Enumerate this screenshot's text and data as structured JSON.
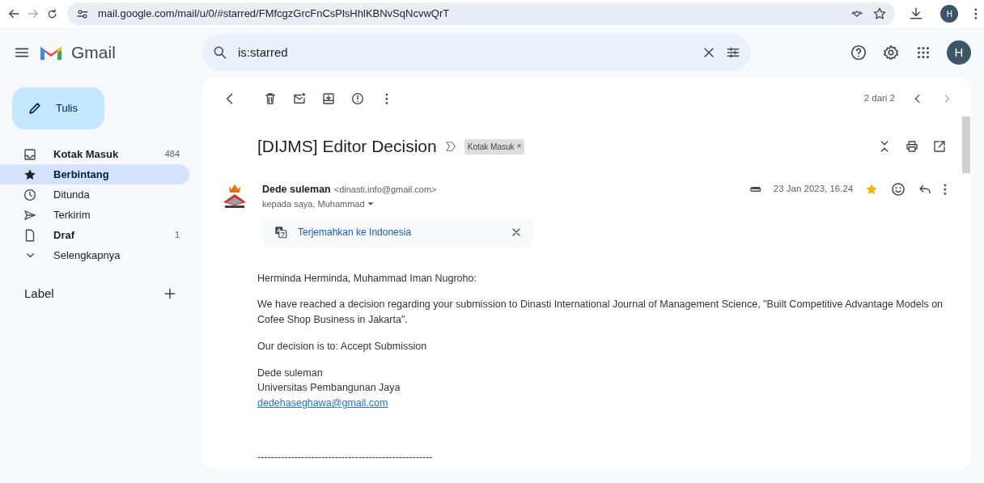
{
  "browser": {
    "url": "mail.google.com/mail/u/0/#starred/FMfcgzGrcFnCsPlsHhlKBNvSqNcvwQrT",
    "profile_initial": "H"
  },
  "header": {
    "app_name": "Gmail",
    "search": {
      "value": "is:starred"
    },
    "avatar_initial": "H"
  },
  "sidebar": {
    "compose": "Tulis",
    "items": [
      {
        "kind": "inbox",
        "label": "Kotak Masuk",
        "count": "484",
        "bold": true,
        "selected": false
      },
      {
        "kind": "star",
        "label": "Berbintang",
        "bold": true,
        "selected": true
      },
      {
        "kind": "clock",
        "label": "Ditunda",
        "bold": false,
        "selected": false
      },
      {
        "kind": "send",
        "label": "Terkirim",
        "bold": false,
        "selected": false
      },
      {
        "kind": "file",
        "label": "Draf",
        "count": "1",
        "bold": true,
        "selected": false
      },
      {
        "kind": "more",
        "label": "Selengkapnya",
        "bold": false,
        "selected": false
      }
    ],
    "labels_heading": "Label"
  },
  "toolbar": {
    "pager": "2 dari 2"
  },
  "email": {
    "subject": "[DIJMS] Editor Decision",
    "label_chip": "Kotak Masuk",
    "label_chip_remove": "×",
    "sender_name": "Dede suleman",
    "sender_email": "<dinasti.info@gmail.com>",
    "recipients": "kepada saya, Muhammad",
    "date": "23 Jan 2023, 16.24",
    "starred": true,
    "translate": "Terjemahkan ke Indonesia",
    "body": [
      {
        "lines": [
          {
            "kind": "text",
            "text": "Herminda Herminda, Muhammad Iman Nugroho:"
          }
        ]
      },
      {
        "lines": [
          {
            "kind": "text",
            "text": "We have reached a decision regarding your submission to Dinasti International Journal of Management Science, \"Built Competitive Advantage Models on Cofee Shop Business in Jakarta\"."
          }
        ]
      },
      {
        "lines": [
          {
            "kind": "text",
            "text": "Our decision is to: Accept Submission"
          }
        ]
      },
      {
        "lines": [
          {
            "kind": "text",
            "text": "Dede suleman"
          },
          {
            "kind": "text",
            "text": "Universitas Pembangunan Jaya"
          },
          {
            "kind": "link",
            "text": "dedehaseghawa@gmail.com"
          }
        ]
      },
      {
        "lines": [
          {
            "kind": "text",
            "text": "----------------------------------------------------"
          }
        ]
      }
    ]
  }
}
